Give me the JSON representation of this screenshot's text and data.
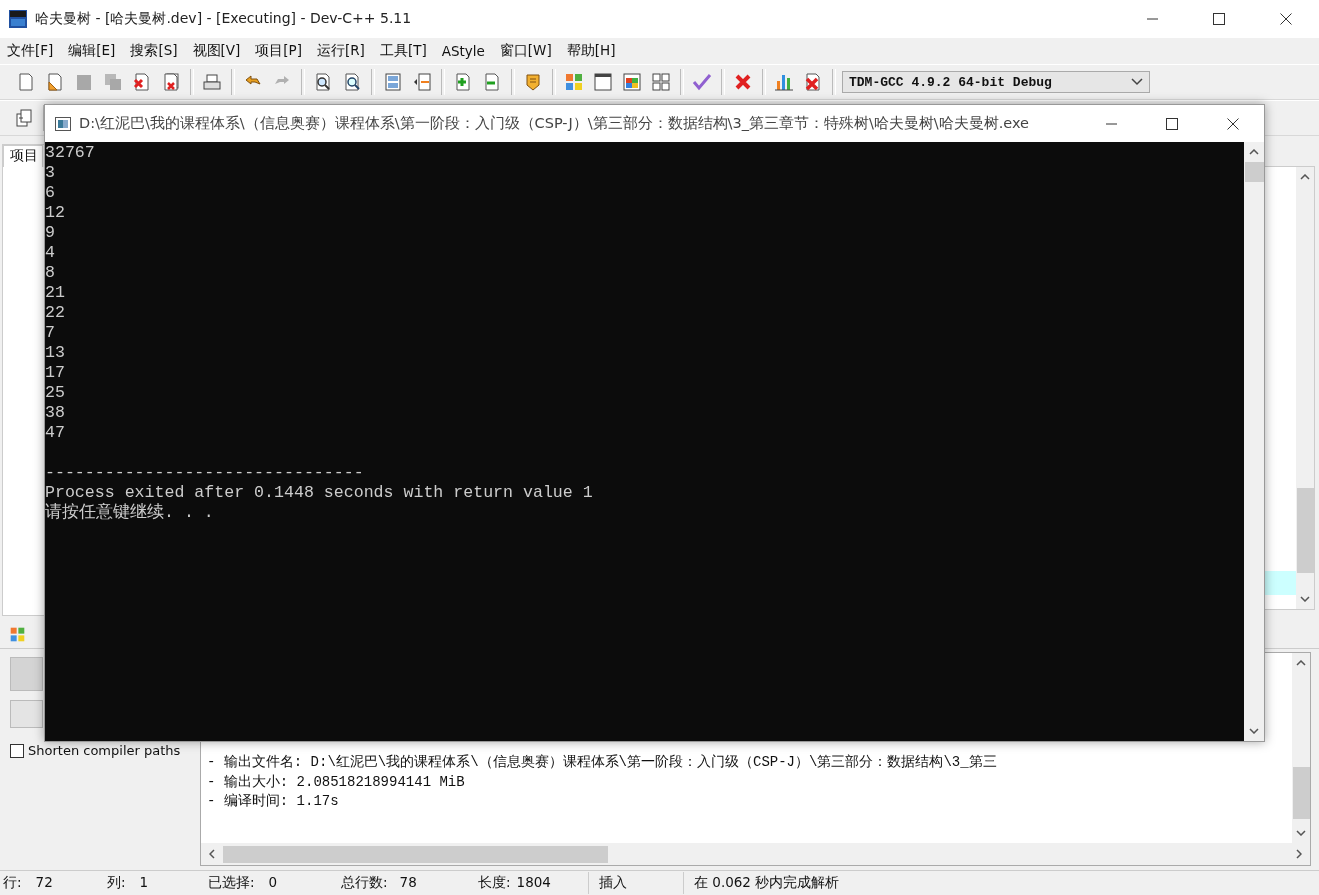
{
  "ide": {
    "title": "哈夫曼树 - [哈夫曼树.dev] - [Executing] - Dev-C++ 5.11",
    "menu": [
      {
        "label": "文件[F]"
      },
      {
        "label": "编辑[E]"
      },
      {
        "label": "搜索[S]"
      },
      {
        "label": "视图[V]"
      },
      {
        "label": "项目[P]"
      },
      {
        "label": "运行[R]"
      },
      {
        "label": "工具[T]"
      },
      {
        "label": "AStyle"
      },
      {
        "label": "窗口[W]"
      },
      {
        "label": "帮助[H]"
      }
    ],
    "compiler_select": {
      "value": "TDM-GCC 4.9.2 64-bit Debug"
    },
    "project_tab": "项目",
    "shorten_paths": {
      "label": "Shorten compiler paths",
      "checked": false
    },
    "compile_log": [
      "- 输出文件名: D:\\红泥巴\\我的课程体系\\（信息奥赛）课程体系\\第一阶段：入门级（CSP-J）\\第三部分：数据结构\\3_第三",
      "- 输出大小: 2.08518218994141 MiB",
      "- 编译时间: 1.17s"
    ],
    "status_bar": [
      {
        "label": "行:",
        "value": "72"
      },
      {
        "label": "列:",
        "value": "1"
      },
      {
        "label": "已选择:",
        "value": "0"
      },
      {
        "label": "总行数:",
        "value": "78"
      },
      {
        "label": "长度:",
        "value": "1804"
      }
    ],
    "insert_mode": "插入",
    "parse_message": "在 0.062 秒内完成解析"
  },
  "console": {
    "title": "D:\\红泥巴\\我的课程体系\\（信息奥赛）课程体系\\第一阶段：入门级（CSP-J）\\第三部分：数据结构\\3_第三章节：特殊树\\哈夫曼树\\哈夫曼树.exe",
    "output": [
      "32767",
      "3",
      "6",
      "12",
      "9",
      "4",
      "8",
      "21",
      "22",
      "7",
      "13",
      "17",
      "25",
      "38",
      "47"
    ],
    "footer": [
      "--------------------------------",
      "Process exited after 0.1448 seconds with return value 1",
      "请按任意键继续. . ."
    ]
  }
}
